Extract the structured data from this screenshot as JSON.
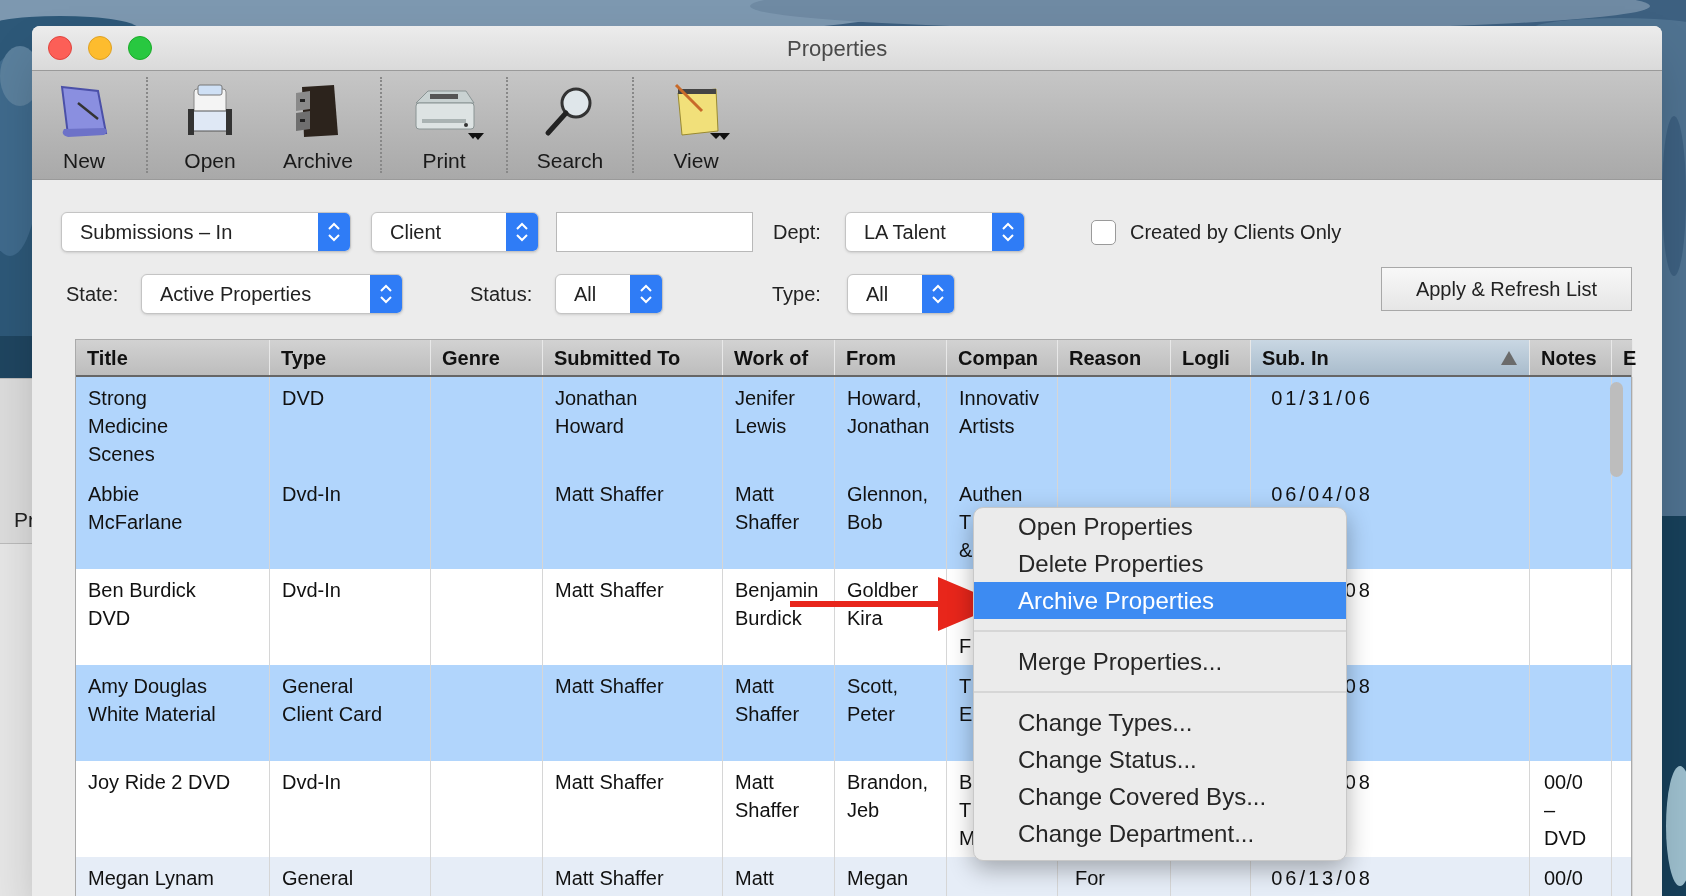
{
  "background_window": {
    "label": "Pr"
  },
  "window": {
    "title": "Properties"
  },
  "toolbar": {
    "groups": [
      {
        "items": [
          {
            "label": "New",
            "kind": "new",
            "has_menu": false
          }
        ]
      },
      {
        "items": [
          {
            "label": "Open",
            "kind": "open",
            "has_menu": false
          },
          {
            "label": "Archive",
            "kind": "archive",
            "has_menu": false
          }
        ]
      },
      {
        "items": [
          {
            "label": "Print",
            "kind": "print",
            "has_menu": true
          }
        ]
      },
      {
        "items": [
          {
            "label": "Search",
            "kind": "search",
            "has_menu": false
          }
        ]
      },
      {
        "items": [
          {
            "label": "View",
            "kind": "view",
            "has_menu": true
          }
        ]
      }
    ]
  },
  "filters": {
    "list": {
      "value": "Submissions – In"
    },
    "search_by": {
      "value": "Client"
    },
    "dept": {
      "label": "Dept:",
      "value": "LA Talent"
    },
    "created_by_clients": {
      "label": "Created by Clients Only",
      "checked": false
    },
    "state": {
      "label": "State:",
      "value": "Active Properties"
    },
    "status": {
      "label": "Status:",
      "value": "All"
    },
    "type": {
      "label": "Type:",
      "value": "All"
    },
    "apply_button": "Apply & Refresh List"
  },
  "table": {
    "columns": [
      {
        "label": "Title",
        "sorted": false
      },
      {
        "label": "Type",
        "sorted": false
      },
      {
        "label": "Genre",
        "sorted": false
      },
      {
        "label": "Submitted To",
        "sorted": false
      },
      {
        "label": "Work of",
        "sorted": false
      },
      {
        "label": "From",
        "sorted": false
      },
      {
        "label": "Compan",
        "sorted": false
      },
      {
        "label": "Reason",
        "sorted": false
      },
      {
        "label": "Logli",
        "sorted": false
      },
      {
        "label": "Sub. In",
        "sorted": true
      },
      {
        "label": "Notes",
        "sorted": false
      },
      {
        "label": "E",
        "sorted": false
      }
    ],
    "rows": [
      {
        "selected": true,
        "title": "Strong\nMedicine\nScenes",
        "type": "DVD",
        "submitted_to": "Jonathan\nHoward",
        "work_of": "Jenifer\nLewis",
        "from": "Howard,\nJonathan",
        "company": "Innovativ\nArtists",
        "sub_in": "01/31/06"
      },
      {
        "selected": true,
        "title": "Abbie\nMcFarlane",
        "type": "Dvd-In",
        "submitted_to": "Matt Shaffer",
        "work_of": "Matt\nShaffer",
        "from": "Glennon,\nBob",
        "company": "Authen\nT\n&",
        "sub_in": "06/04/08"
      },
      {
        "selected": false,
        "title": "Ben Burdick\nDVD",
        "type": "Dvd-In",
        "submitted_to": "Matt Shaffer",
        "work_of": "Benjamin\nBurdick",
        "from": "Goldber\nKira",
        "company": "\n\nF",
        "sub_in": "08"
      },
      {
        "selected": true,
        "title": "Amy Douglas\nWhite Material",
        "type": "General\nClient Card",
        "submitted_to": "Matt Shaffer",
        "work_of": "Matt\nShaffer",
        "from": "Scott,\nPeter",
        "company": "T\nE",
        "sub_in": "08"
      },
      {
        "selected": false,
        "title": "Joy Ride 2 DVD",
        "type": "Dvd-In",
        "submitted_to": "Matt Shaffer",
        "work_of": "Matt\nShaffer",
        "from": "Brandon,\nJeb",
        "company": "B\nT\nM",
        "sub_in": "08",
        "notes": "00/0\n–\nDVD"
      },
      {
        "selected": false,
        "title": "Megan Lynam",
        "type": "General",
        "submitted_to": "Matt Shaffer",
        "work_of": "Matt",
        "from": "Megan",
        "reason": "For",
        "sub_in": "06/13/08",
        "notes": "00/0"
      }
    ]
  },
  "context_menu": {
    "sections": [
      {
        "items": [
          {
            "label": "Open Properties",
            "selected": false
          },
          {
            "label": "Delete Properties",
            "selected": false
          },
          {
            "label": "Archive Properties",
            "selected": true
          }
        ]
      },
      {
        "items": [
          {
            "label": "Merge Properties...",
            "selected": false
          }
        ]
      },
      {
        "items": [
          {
            "label": "Change Types...",
            "selected": false
          },
          {
            "label": "Change Status...",
            "selected": false
          },
          {
            "label": "Change Covered Bys...",
            "selected": false
          },
          {
            "label": "Change Department...",
            "selected": false
          }
        ]
      }
    ]
  }
}
